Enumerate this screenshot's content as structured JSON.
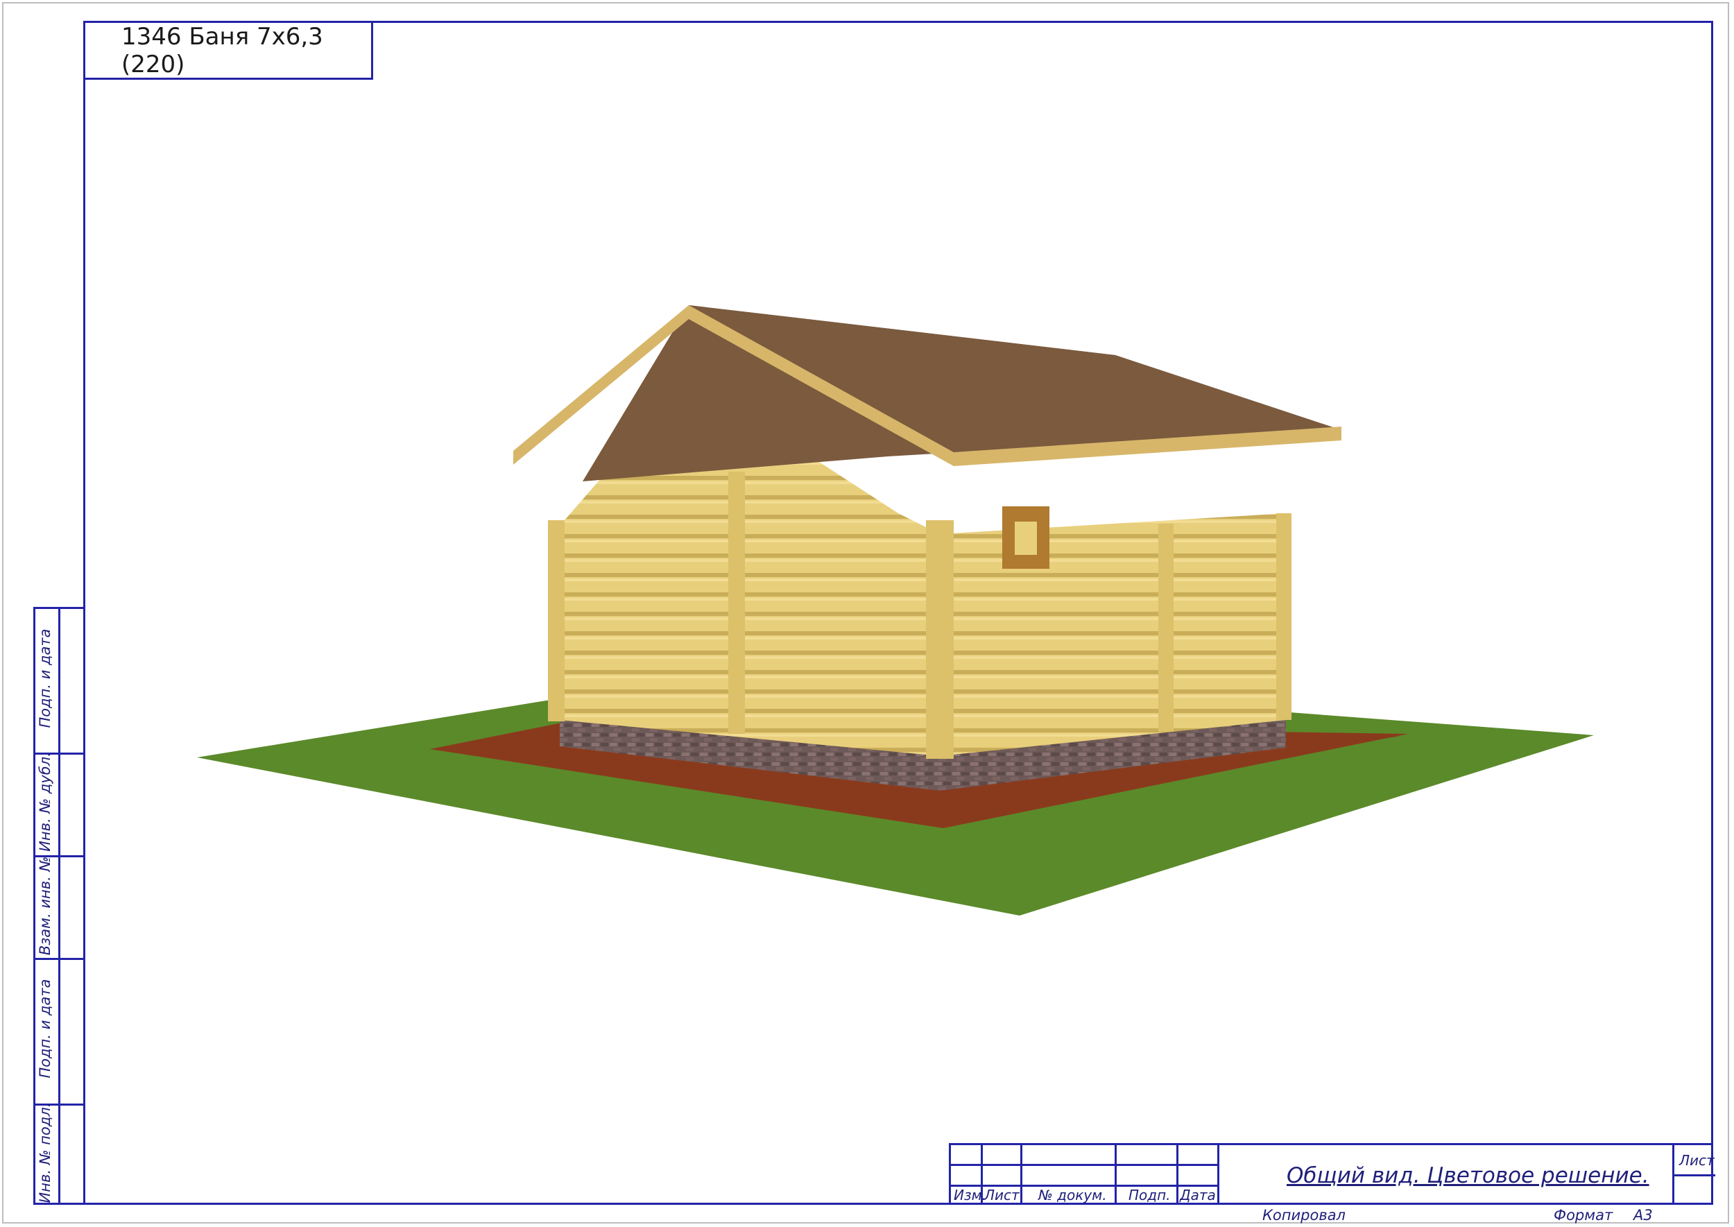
{
  "sheet": {
    "project_title": "1346 Баня 7х6,3 (220)",
    "drawing_title": "Общий вид. Цветовое решение.",
    "format_label": "Формат",
    "format_value": "А3",
    "copied_label": "Копировал",
    "sheet_label": "Лист"
  },
  "stamp_columns": [
    "Изм.",
    "Лист",
    "№ докум.",
    "Подп.",
    "Дата"
  ],
  "side_labels": [
    "Подп. и дата",
    "Инв. № дубл.",
    "Взам. инв. №",
    "Подп. и дата",
    "Инв. № подл."
  ],
  "drawing": {
    "colors": {
      "grass": "#5b8a2a",
      "paving": "#8a3a1c",
      "brick": "#6d5a58",
      "logs": "#e8cf7c",
      "roof": "#7b5a3e",
      "window": "#b07a30"
    }
  }
}
